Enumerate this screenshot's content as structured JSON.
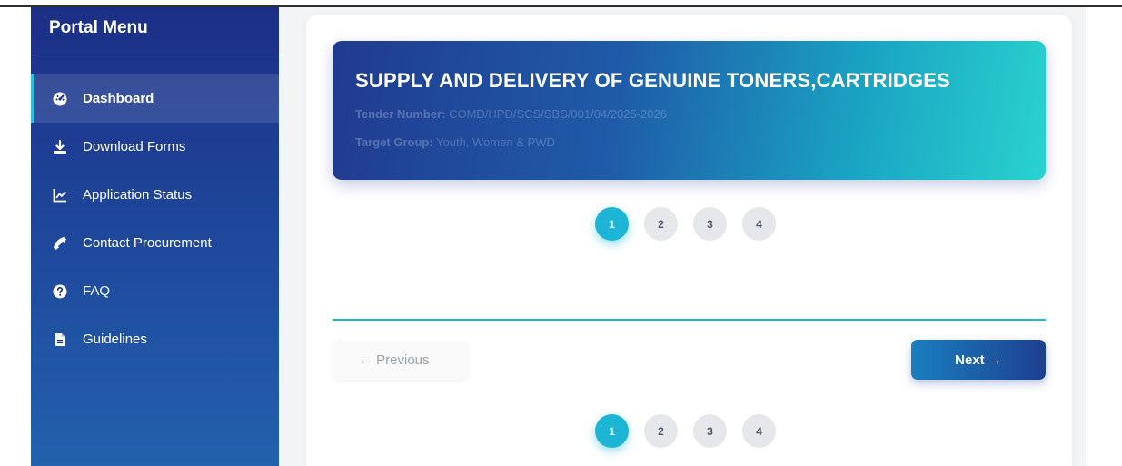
{
  "sidebar": {
    "title": "Portal Menu",
    "items": [
      {
        "label": "Dashboard",
        "icon": "dashboard-icon",
        "active": true
      },
      {
        "label": "Download Forms",
        "icon": "download-icon",
        "active": false
      },
      {
        "label": "Application Status",
        "icon": "chart-line-icon",
        "active": false
      },
      {
        "label": "Contact Procurement",
        "icon": "phone-icon",
        "active": false
      },
      {
        "label": "FAQ",
        "icon": "question-circle-icon",
        "active": false
      },
      {
        "label": "Guidelines",
        "icon": "file-icon",
        "active": false
      }
    ]
  },
  "banner": {
    "title": "SUPPLY AND DELIVERY OF GENUINE TONERS,CARTRIDGES",
    "tender_label": "Tender Number:",
    "tender_value": "COMD/HPD/SCS/SBS/001/04/2025-2026",
    "target_label": "Target Group:",
    "target_value": "Youth, Women & PWD"
  },
  "steps_top": [
    "1",
    "2",
    "3",
    "4"
  ],
  "steps_bottom": [
    "1",
    "2",
    "3",
    "4"
  ],
  "active_step": 1,
  "buttons": {
    "previous": "← Previous",
    "next": "Next →"
  },
  "colors": {
    "accent": "#1cb5d5",
    "sidebar": "#1c2f86",
    "next_button": "#1d3f8f"
  }
}
